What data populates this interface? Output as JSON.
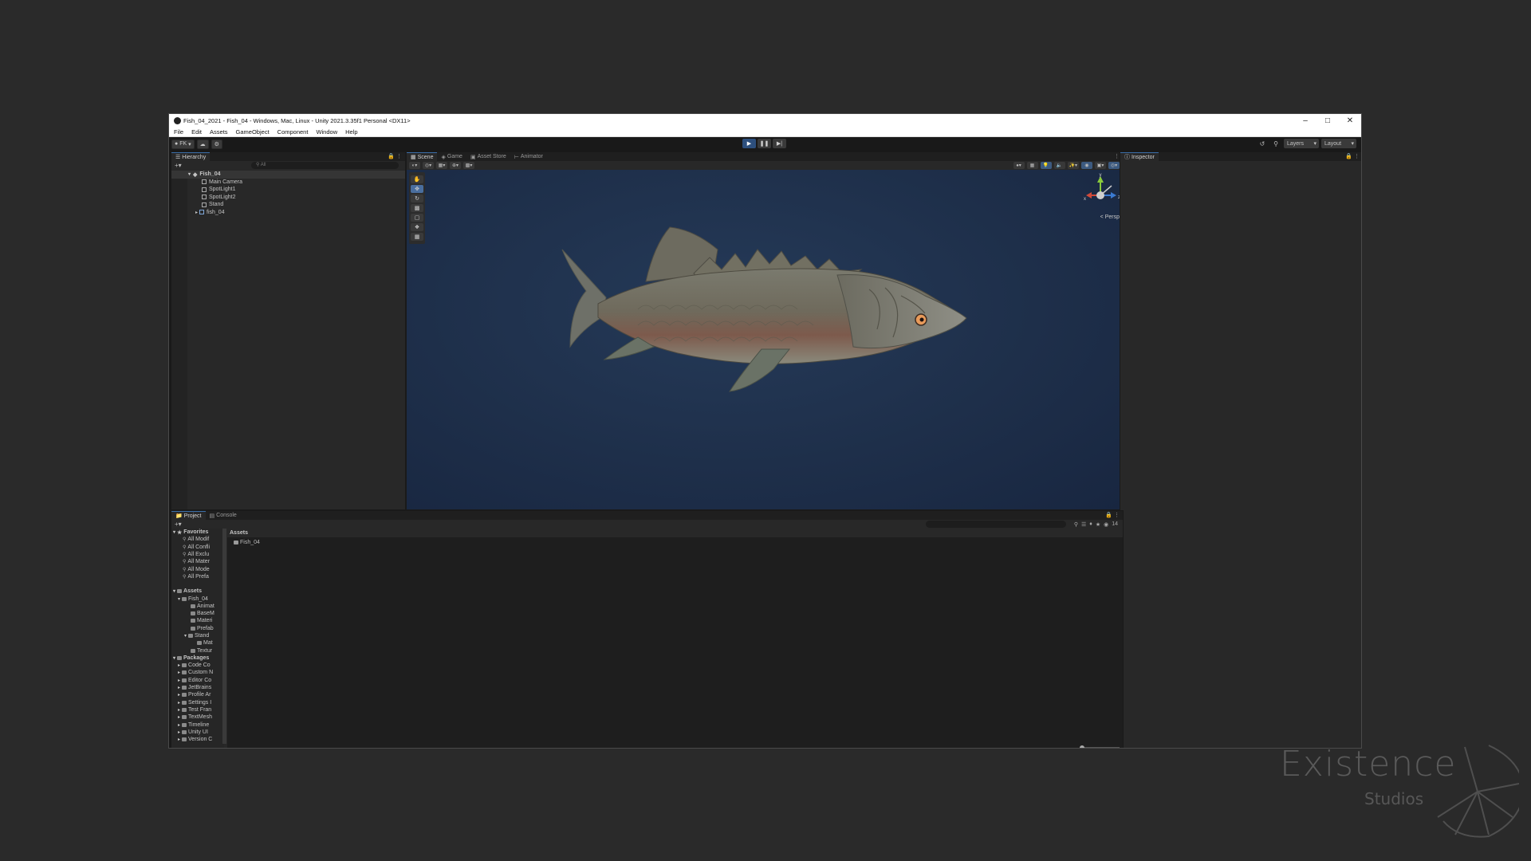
{
  "window": {
    "title": "Fish_04_2021 - Fish_04 - Windows, Mac, Linux - Unity 2021.3.35f1 Personal <DX11>"
  },
  "menu": [
    "File",
    "Edit",
    "Assets",
    "GameObject",
    "Component",
    "Window",
    "Help"
  ],
  "toolbar": {
    "account_label": "FK",
    "layers_label": "Layers",
    "layout_label": "Layout",
    "play_state": "playing"
  },
  "hierarchy": {
    "tab_label": "Hierarchy",
    "search_placeholder": "All",
    "items": [
      {
        "label": "Fish_04",
        "type": "scene"
      },
      {
        "label": "Main Camera"
      },
      {
        "label": "SpotLight1"
      },
      {
        "label": "SpotLight2"
      },
      {
        "label": "Stand"
      },
      {
        "label": "fish_04"
      }
    ]
  },
  "scene_tabs": [
    "Scene",
    "Game",
    "Asset Store",
    "Animator"
  ],
  "scene": {
    "persp_label": "< Persp",
    "gizmo_axes": [
      "y",
      "x",
      "z"
    ],
    "accent": "#3b6ea8",
    "background": "#1e2f4a"
  },
  "inspector": {
    "tab_label": "Inspector"
  },
  "project": {
    "tabs": [
      "Project",
      "Console"
    ],
    "badge_count": "14",
    "favorites_label": "Favorites",
    "favorites": [
      "All Modif",
      "All Confli",
      "All Exclu",
      "All Mater",
      "All Mode",
      "All Prefa"
    ],
    "assets_label": "Assets",
    "asset_tree": [
      {
        "label": "Fish_04",
        "depth": 1
      },
      {
        "label": "Animat",
        "depth": 2
      },
      {
        "label": "BaseM",
        "depth": 2
      },
      {
        "label": "Materi",
        "depth": 2
      },
      {
        "label": "Prefab",
        "depth": 2
      },
      {
        "label": "Stand",
        "depth": 2
      },
      {
        "label": "Mat",
        "depth": 3
      },
      {
        "label": "Textur",
        "depth": 2
      }
    ],
    "packages_label": "Packages",
    "packages": [
      "Code Co",
      "Custom N",
      "Editor Co",
      "JetBrains",
      "Profile Ar",
      "Settings I",
      "Test Fran",
      "TextMesh",
      "Timeline",
      "Unity UI",
      "Version C"
    ],
    "breadcrumb": "Assets",
    "content_items": [
      "Fish_04"
    ]
  },
  "watermark": {
    "title": "Existence",
    "subtitle": "Studios"
  }
}
